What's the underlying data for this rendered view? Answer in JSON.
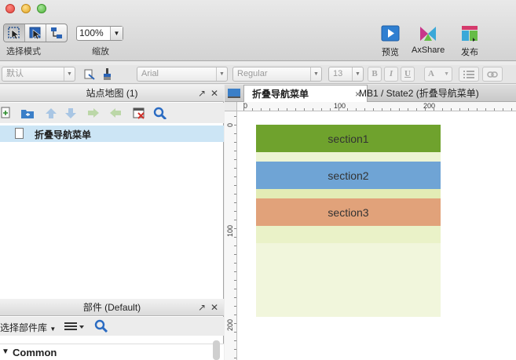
{
  "toolbar": {
    "select_mode_label": "选择模式",
    "zoom_value": "100%",
    "zoom_label": "缩放",
    "preview_label": "预览",
    "axshare_label": "AxShare",
    "publish_label": "发布"
  },
  "format": {
    "style": "默认",
    "font": "Arial",
    "weight": "Regular",
    "size": "13",
    "bold": "B",
    "italic": "I",
    "underline": "U",
    "text_color": "A"
  },
  "sitemap": {
    "title": "站点地图 (1)",
    "pages": [
      {
        "label": "折叠导航菜单"
      }
    ]
  },
  "widgets": {
    "title": "部件 (Default)",
    "library_label": "选择部件库",
    "group_label": "Common"
  },
  "editor": {
    "tabs": [
      {
        "label": "折叠导航菜单",
        "close": "×"
      },
      {
        "label": "MB1 / State2 (折叠导航菜单)"
      }
    ],
    "ruler_h": [
      "0",
      "100",
      "200"
    ],
    "ruler_v": [
      "0",
      "100",
      "200"
    ],
    "sections": [
      {
        "label": "section1",
        "color": "#6fa22d"
      },
      {
        "label": "section2",
        "color": "#6fa4d5"
      },
      {
        "label": "section3",
        "color": "#e1a27a"
      }
    ],
    "filler_colors": [
      "#edf4d3",
      "#e3ecb5",
      "#eaf2c8",
      "#f1f6dc"
    ]
  }
}
